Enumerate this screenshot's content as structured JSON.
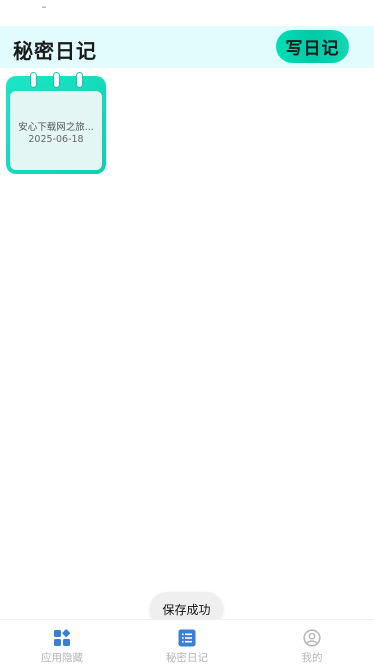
{
  "status_bar": {
    "indicator": "ᵃᴬ"
  },
  "header": {
    "title": "秘密日记",
    "write_button_label": "写日记"
  },
  "diary_entries": [
    {
      "title": "安心下载网之旅...",
      "date": "2025-06-18"
    }
  ],
  "toast": {
    "message": "保存成功"
  },
  "tab_bar": {
    "tabs": [
      {
        "label": "应用隐藏",
        "icon": "apps-grid-icon",
        "active": false
      },
      {
        "label": "秘密日记",
        "icon": "list-icon",
        "active": true
      },
      {
        "label": "我的",
        "icon": "user-circle-icon",
        "active": false
      }
    ]
  },
  "colors": {
    "header_bg": "#e2fbfd",
    "accent": "#00c9a7",
    "tab_active_icon": "#3a7fd6",
    "tab_inactive": "#b5b5b5"
  }
}
